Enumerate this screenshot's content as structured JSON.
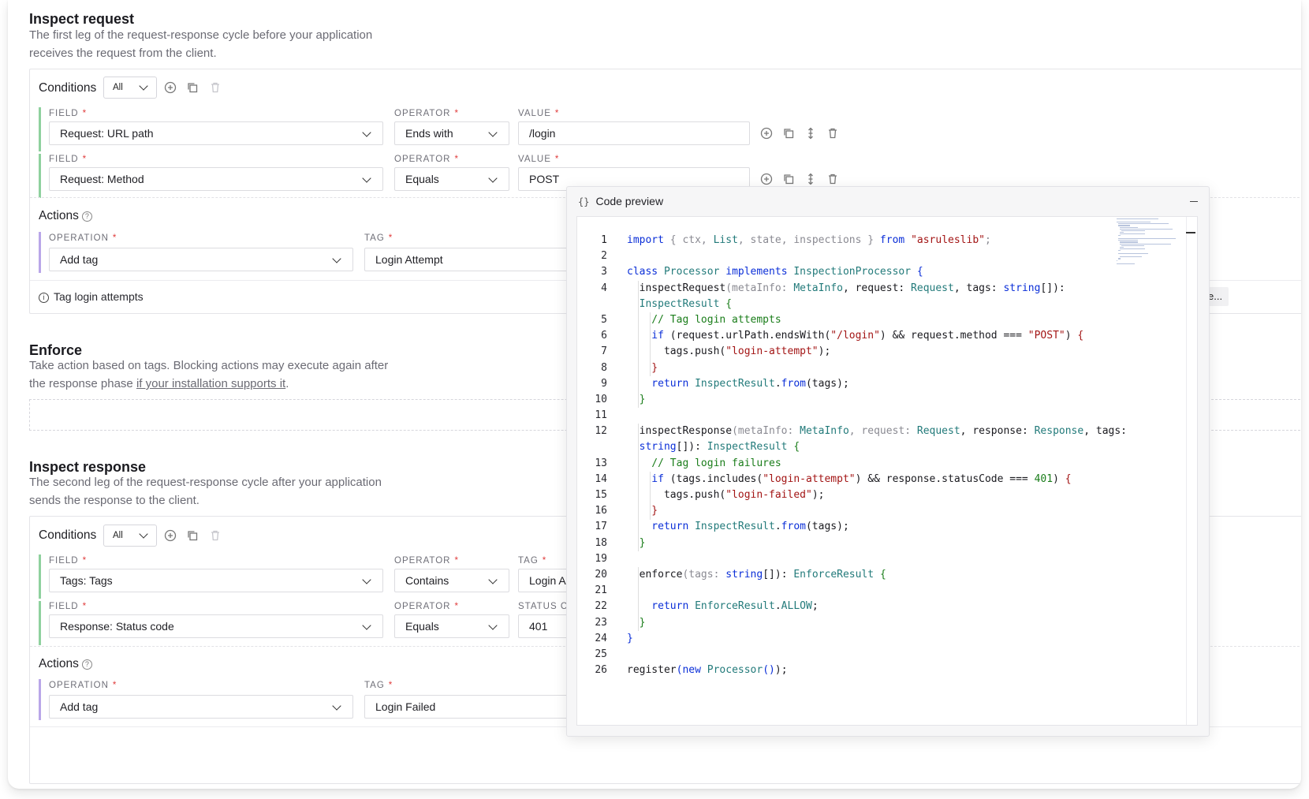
{
  "inspect_request": {
    "title": "Inspect request",
    "description_line1": "The first leg of the request-response cycle before your application",
    "description_line2": "receives the request from the client.",
    "conditions": {
      "label": "Conditions",
      "match_select": "All",
      "rows": [
        {
          "field_label": "FIELD",
          "field": "Request: URL path",
          "operator_label": "OPERATOR",
          "operator": "Ends with",
          "value_label": "VALUE",
          "value": "/login"
        },
        {
          "field_label": "FIELD",
          "field": "Request: Method",
          "operator_label": "OPERATOR",
          "operator": "Equals",
          "value_label": "VALUE",
          "value": "POST"
        }
      ]
    },
    "actions": {
      "label": "Actions",
      "help": "?",
      "operation_label": "OPERATION",
      "operation": "Add tag",
      "tag_label": "TAG",
      "tag": "Login Attempt"
    },
    "footer_note": "Tag login attempts",
    "partial_button": "e..."
  },
  "enforce": {
    "title": "Enforce",
    "description_line1": "Take action based on tags. Blocking actions may execute again after",
    "description_prefix": "the response phase ",
    "description_link": "if your installation supports it",
    "description_suffix": "."
  },
  "inspect_response": {
    "title": "Inspect response",
    "description_line1": "The second leg of the request-response cycle after your application",
    "description_line2": "sends the response to the client.",
    "conditions": {
      "label": "Conditions",
      "match_select": "All",
      "rows": [
        {
          "field_label": "FIELD",
          "field": "Tags: Tags",
          "operator_label": "OPERATOR",
          "operator": "Contains",
          "value_label": "TAG",
          "value": "Login A"
        },
        {
          "field_label": "FIELD",
          "field": "Response: Status code",
          "operator_label": "OPERATOR",
          "operator": "Equals",
          "value_label": "STATUS C",
          "value": "401"
        }
      ]
    },
    "actions": {
      "label": "Actions",
      "help": "?",
      "operation_label": "OPERATION",
      "operation": "Add tag",
      "tag_label": "TAG",
      "tag": "Login Failed"
    }
  },
  "code_preview": {
    "title": "Code preview",
    "icon": "{}",
    "lines": [
      [
        {
          "c": "kw",
          "t": "import"
        },
        {
          "c": "dm",
          "t": " { "
        },
        {
          "c": "dm",
          "t": "ctx, "
        },
        {
          "c": "ty",
          "t": "List"
        },
        {
          "c": "dm",
          "t": ", state, inspections } "
        },
        {
          "c": "kw",
          "t": "from "
        },
        {
          "c": "st",
          "t": "\"asruleslib\""
        },
        {
          "c": "dm",
          "t": ";"
        }
      ],
      [],
      [
        {
          "c": "kw",
          "t": "class "
        },
        {
          "c": "ty",
          "t": "Processor "
        },
        {
          "c": "kw",
          "t": "implements "
        },
        {
          "c": "ty",
          "t": "InspectionProcessor "
        },
        {
          "c": "kw",
          "t": "{"
        }
      ],
      [
        {
          "c": "bk",
          "t": "  inspectRequest"
        },
        {
          "c": "dm",
          "t": "(metaInfo: "
        },
        {
          "c": "ty",
          "t": "MetaInfo"
        },
        {
          "c": "bk",
          "t": ", request: "
        },
        {
          "c": "ty",
          "t": "Request"
        },
        {
          "c": "bk",
          "t": ", tags: "
        },
        {
          "c": "kw",
          "t": "string"
        },
        {
          "c": "bk",
          "t": "[]):"
        }
      ],
      [
        {
          "c": "ty",
          "t": "  InspectResult "
        },
        {
          "c": "cm",
          "t": "{"
        }
      ],
      [
        {
          "c": "cm",
          "t": "    // Tag login attempts"
        }
      ],
      [
        {
          "c": "kw",
          "t": "    if "
        },
        {
          "c": "bk",
          "t": "(request.urlPath.endsWith("
        },
        {
          "c": "st",
          "t": "\"/login\""
        },
        {
          "c": "bk",
          "t": ") && request.method === "
        },
        {
          "c": "st",
          "t": "\"POST\""
        },
        {
          "c": "bk",
          "t": ") "
        },
        {
          "c": "st",
          "t": "{"
        }
      ],
      [
        {
          "c": "bk",
          "t": "      tags.push("
        },
        {
          "c": "st",
          "t": "\"login-attempt\""
        },
        {
          "c": "bk",
          "t": ");"
        }
      ],
      [
        {
          "c": "st",
          "t": "    }"
        }
      ],
      [
        {
          "c": "kw",
          "t": "    return "
        },
        {
          "c": "ty",
          "t": "InspectResult"
        },
        {
          "c": "bk",
          "t": "."
        },
        {
          "c": "kw",
          "t": "from"
        },
        {
          "c": "bk",
          "t": "(tags);"
        }
      ],
      [
        {
          "c": "cm",
          "t": "  }"
        }
      ],
      [],
      [
        {
          "c": "bk",
          "t": "  inspectResponse"
        },
        {
          "c": "dm",
          "t": "(metaInfo: "
        },
        {
          "c": "ty",
          "t": "MetaInfo"
        },
        {
          "c": "dm",
          "t": ", request: "
        },
        {
          "c": "ty",
          "t": "Request"
        },
        {
          "c": "bk",
          "t": ", response: "
        },
        {
          "c": "ty",
          "t": "Response"
        },
        {
          "c": "bk",
          "t": ", tags:"
        }
      ],
      [
        {
          "c": "kw",
          "t": "  string"
        },
        {
          "c": "bk",
          "t": "[]): "
        },
        {
          "c": "ty",
          "t": "InspectResult "
        },
        {
          "c": "cm",
          "t": "{"
        }
      ],
      [
        {
          "c": "cm",
          "t": "    // Tag login failures"
        }
      ],
      [
        {
          "c": "kw",
          "t": "    if "
        },
        {
          "c": "bk",
          "t": "(tags.includes("
        },
        {
          "c": "st",
          "t": "\"login-attempt\""
        },
        {
          "c": "bk",
          "t": ") && response.statusCode === "
        },
        {
          "c": "cm",
          "t": "401"
        },
        {
          "c": "bk",
          "t": ") "
        },
        {
          "c": "st",
          "t": "{"
        }
      ],
      [
        {
          "c": "bk",
          "t": "      tags.push("
        },
        {
          "c": "st",
          "t": "\"login-failed\""
        },
        {
          "c": "bk",
          "t": ");"
        }
      ],
      [
        {
          "c": "st",
          "t": "    }"
        }
      ],
      [
        {
          "c": "kw",
          "t": "    return "
        },
        {
          "c": "ty",
          "t": "InspectResult"
        },
        {
          "c": "bk",
          "t": "."
        },
        {
          "c": "kw",
          "t": "from"
        },
        {
          "c": "bk",
          "t": "(tags);"
        }
      ],
      [
        {
          "c": "cm",
          "t": "  }"
        }
      ],
      [],
      [
        {
          "c": "bk",
          "t": "  enforce"
        },
        {
          "c": "dm",
          "t": "(tags: "
        },
        {
          "c": "kw",
          "t": "string"
        },
        {
          "c": "bk",
          "t": "[]): "
        },
        {
          "c": "ty",
          "t": "EnforceResult "
        },
        {
          "c": "cm",
          "t": "{"
        }
      ],
      [],
      [
        {
          "c": "kw",
          "t": "    return "
        },
        {
          "c": "ty",
          "t": "EnforceResult"
        },
        {
          "c": "bk",
          "t": "."
        },
        {
          "c": "ty",
          "t": "ALLOW"
        },
        {
          "c": "bk",
          "t": ";"
        }
      ],
      [
        {
          "c": "cm",
          "t": "  }"
        }
      ],
      [
        {
          "c": "kw",
          "t": "}"
        }
      ],
      [],
      [
        {
          "c": "bk",
          "t": "register"
        },
        {
          "c": "kw",
          "t": "(new "
        },
        {
          "c": "ty",
          "t": "Processor"
        },
        {
          "c": "kw",
          "t": "()"
        },
        {
          "c": "bk",
          "t": ");"
        }
      ]
    ],
    "line_numbers": [
      "1",
      "2",
      "3",
      "4",
      "",
      "5",
      "6",
      "7",
      "8",
      "9",
      "10",
      "11",
      "12",
      "",
      "13",
      "14",
      "15",
      "16",
      "17",
      "18",
      "19",
      "20",
      "21",
      "22",
      "23",
      "24",
      "25",
      "26"
    ]
  }
}
